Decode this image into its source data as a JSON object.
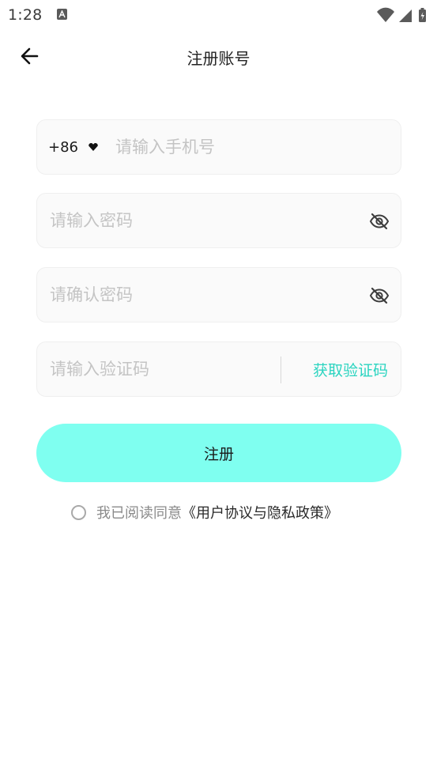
{
  "status_bar": {
    "time": "1:28"
  },
  "header": {
    "title": "注册账号",
    "back_icon": "arrow-left-icon"
  },
  "phone_field": {
    "country_code": "+86",
    "placeholder": "请输入手机号",
    "value": ""
  },
  "password_field": {
    "placeholder": "请输入密码",
    "value": "",
    "toggle_icon": "eye-off-icon"
  },
  "confirm_password_field": {
    "placeholder": "请确认密码",
    "value": "",
    "toggle_icon": "eye-off-icon"
  },
  "code_field": {
    "placeholder": "请输入验证码",
    "value": "",
    "get_code_label": "获取验证码"
  },
  "register_button": {
    "label": "注册"
  },
  "agreement": {
    "checked": false,
    "prefix": "我已阅读同意",
    "link_text": "《用户协议与隐私政策》"
  },
  "colors": {
    "accent": "#7ffff0",
    "link_accent": "#2ad4c0",
    "placeholder": "#c4c4c4",
    "field_background": "#fafafa"
  }
}
